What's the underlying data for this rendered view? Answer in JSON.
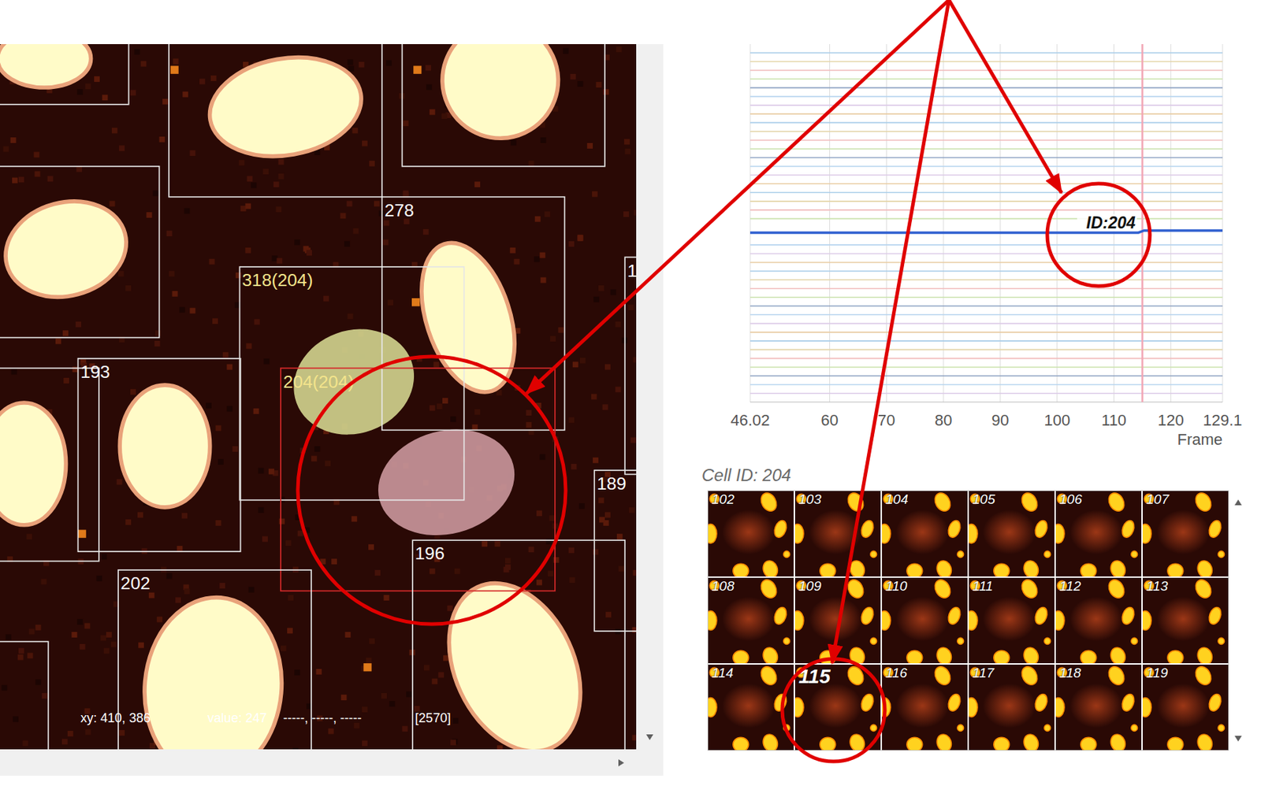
{
  "image_view": {
    "boxes": [
      {
        "label": "278",
        "color": "#e6e6e6",
        "label_color": "#ffffff"
      },
      {
        "label": "318(204)",
        "color": "#e6e6e6",
        "label_color": "#f3e48c"
      },
      {
        "label": "193",
        "color": "#e6e6e6",
        "label_color": "#ffffff"
      },
      {
        "label": "204(204)",
        "color": "#d42a2a",
        "label_color": "#f3e48c"
      },
      {
        "label": "196",
        "color": "#e6e6e6",
        "label_color": "#ffffff"
      },
      {
        "label": "202",
        "color": "#e6e6e6",
        "label_color": "#ffffff"
      },
      {
        "label": "189",
        "color": "#e6e6e6",
        "label_color": "#ffffff"
      },
      {
        "label": "1",
        "color": "#e6e6e6",
        "label_color": "#ffffff"
      }
    ],
    "status": {
      "xy": "xy: 410, 386",
      "value": "value: 247",
      "channels": "-----, -----, -----",
      "count": "[2570]"
    }
  },
  "chart": {
    "domain": [
      46.02,
      129.1
    ],
    "ticks": [
      {
        "label": "46.02",
        "value": 46.02
      },
      {
        "label": "60",
        "value": 60
      },
      {
        "label": "70",
        "value": 70
      },
      {
        "label": "80",
        "value": 80
      },
      {
        "label": "90",
        "value": 90
      },
      {
        "label": "100",
        "value": 100
      },
      {
        "label": "110",
        "value": 110
      },
      {
        "label": "120",
        "value": 120
      },
      {
        "label": "129.1",
        "value": 129.1
      }
    ],
    "axis_title": "Frame",
    "cursor_frame": 115,
    "tracks": [
      {
        "color": "#a9cde9",
        "value": 1
      },
      {
        "color": "#e4d5a8",
        "value": 2
      },
      {
        "color": "#f1bcbc",
        "value": 3
      },
      {
        "color": "#cbe3ae",
        "value": 4
      },
      {
        "color": "#8fa4c4",
        "value": 5
      },
      {
        "color": "#b8d5ef",
        "value": 6
      },
      {
        "color": "#dccbe8",
        "value": 7
      },
      {
        "color": "#e9cda4",
        "value": 8
      },
      {
        "color": "#a9cde9",
        "value": 9
      },
      {
        "color": "#e4d5a8",
        "value": 10
      },
      {
        "color": "#f1bcbc",
        "value": 11
      },
      {
        "color": "#cbe3ae",
        "value": 12
      },
      {
        "color": "#8fa4c4",
        "value": 13
      },
      {
        "color": "#b8d5ef",
        "value": 14
      },
      {
        "color": "#dccbe8",
        "value": 15
      },
      {
        "color": "#e9cda4",
        "value": 16
      },
      {
        "color": "#a9cde9",
        "value": 17
      },
      {
        "color": "#e4d5a8",
        "value": 18
      },
      {
        "color": "#f1bcbc",
        "value": 19
      },
      {
        "color": "#cbe3ae",
        "value": 20
      },
      {
        "color": "#b8d5ef",
        "value": 23
      },
      {
        "color": "#dccbe8",
        "value": 24
      },
      {
        "color": "#e9cda4",
        "value": 25
      },
      {
        "color": "#a9cde9",
        "value": 26
      },
      {
        "color": "#e4d5a8",
        "value": 27
      },
      {
        "color": "#f1bcbc",
        "value": 28
      },
      {
        "color": "#cbe3ae",
        "value": 29
      },
      {
        "color": "#8fa4c4",
        "value": 30
      },
      {
        "color": "#b8d5ef",
        "value": 31
      },
      {
        "color": "#dccbe8",
        "value": 32
      },
      {
        "color": "#e9cda4",
        "value": 33
      },
      {
        "color": "#a9cde9",
        "value": 34
      },
      {
        "color": "#e4d5a8",
        "value": 35
      },
      {
        "color": "#f1bcbc",
        "value": 36
      },
      {
        "color": "#cbe3ae",
        "value": 37
      },
      {
        "color": "#8fa4c4",
        "value": 38
      },
      {
        "color": "#b8d5ef",
        "value": 39
      },
      {
        "color": "#dccbe8",
        "value": 40
      }
    ],
    "highlight": {
      "label": "ID:204",
      "color": "#2f5fd0",
      "points": [
        [
          46.02,
          21.6
        ],
        [
          114.3,
          21.6
        ],
        [
          115.3,
          21.35
        ],
        [
          129.1,
          21.35
        ]
      ]
    }
  },
  "cell_panel": {
    "title": "Cell ID: 204",
    "frames": [
      {
        "label": "102",
        "selected": false
      },
      {
        "label": "103",
        "selected": false
      },
      {
        "label": "104",
        "selected": false
      },
      {
        "label": "105",
        "selected": false
      },
      {
        "label": "106",
        "selected": false
      },
      {
        "label": "107",
        "selected": false
      },
      {
        "label": "108",
        "selected": false
      },
      {
        "label": "109",
        "selected": false
      },
      {
        "label": "110",
        "selected": false
      },
      {
        "label": "111",
        "selected": false
      },
      {
        "label": "112",
        "selected": false
      },
      {
        "label": "113",
        "selected": false
      },
      {
        "label": "114",
        "selected": false
      },
      {
        "label": "115",
        "selected": true
      },
      {
        "label": "116",
        "selected": false
      },
      {
        "label": "117",
        "selected": false
      },
      {
        "label": "118",
        "selected": false
      },
      {
        "label": "119",
        "selected": false
      }
    ]
  }
}
